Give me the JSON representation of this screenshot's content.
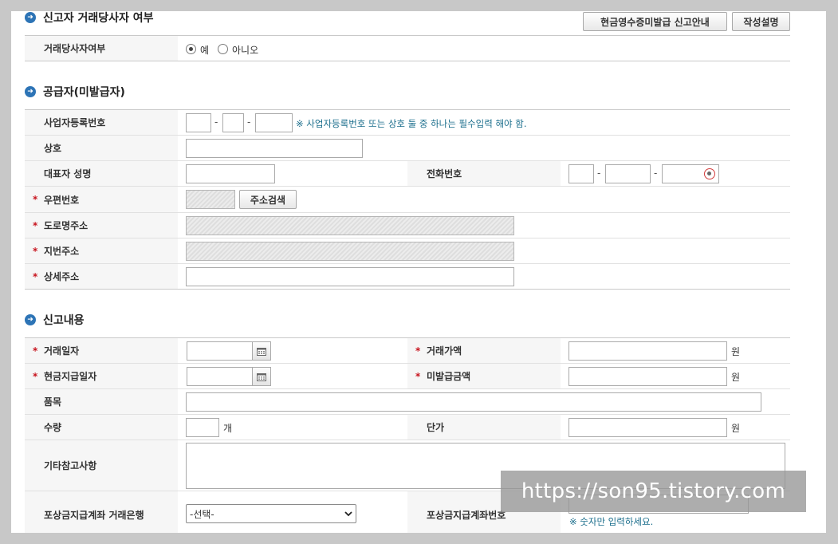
{
  "sections": {
    "transaction": {
      "title": "신고자 거래당사자 여부"
    },
    "supplier": {
      "title": "공급자(미발급자)"
    },
    "report": {
      "title": "신고내용"
    }
  },
  "buttons": {
    "guide": "현금영수증미발급 신고안내",
    "howto": "작성설명",
    "address_search": "주소검색"
  },
  "transaction": {
    "label": "거래당사자여부",
    "options": [
      {
        "label": "예",
        "selected": true
      },
      {
        "label": "아니오",
        "selected": false
      }
    ]
  },
  "supplier": {
    "biz_no_label": "사업자등록번호",
    "biz_no_note": "※ 사업자등록번호 또는 상호 둘 중 하나는 필수입력 해야 함.",
    "trade_name_label": "상호",
    "rep_name_label": "대표자 성명",
    "phone_label": "전화번호",
    "zip_label": "우편번호",
    "road_addr_label": "도로명주소",
    "lot_addr_label": "지번주소",
    "detail_addr_label": "상세주소",
    "dash": "-"
  },
  "report": {
    "trade_date_label": "거래일자",
    "trade_amount_label": "거래가액",
    "cash_date_label": "현금지급일자",
    "unissued_amount_label": "미발급금액",
    "item_label": "품목",
    "quantity_label": "수량",
    "unit_price_label": "단가",
    "remarks_label": "기타참고사항",
    "bank_label": "포상금지급계좌 거래은행",
    "account_label": "포상금지급계좌번호",
    "bank_select_value": "-선택-",
    "account_note": "※ 숫자만 입력하세요.",
    "won": "원",
    "unit": "개"
  },
  "watermark": "https://son95.tistory.com",
  "colors": {
    "required": "#c8141e",
    "bullet": "#2d74b6",
    "note": "#1b6e8c",
    "header_bg": "#f6f6f6"
  },
  "required_mark": "*",
  "bullet_glyph": "➜"
}
